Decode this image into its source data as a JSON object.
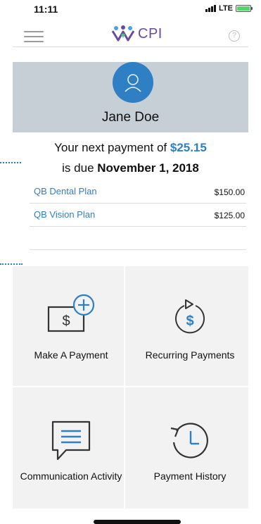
{
  "status": {
    "time": "11:11",
    "network": "LTE"
  },
  "header": {
    "logo_text": "CPI",
    "help_symbol": "?"
  },
  "profile": {
    "name": "Jane Doe"
  },
  "payment": {
    "prefix": "Your next payment of ",
    "amount": "$25.15",
    "due_prefix": "is due ",
    "due_date": "November 1, 2018"
  },
  "plans": [
    {
      "name": "QB Dental Plan",
      "amount": "$150.00"
    },
    {
      "name": "QB Vision Plan",
      "amount": "$125.00"
    }
  ],
  "tiles": [
    {
      "label": "Make A Payment",
      "icon": "make-payment-icon"
    },
    {
      "label": "Recurring Payments",
      "icon": "recurring-payments-icon"
    },
    {
      "label": "Communication Activity",
      "icon": "communication-icon"
    },
    {
      "label": "Payment History",
      "icon": "history-icon"
    }
  ],
  "colors": {
    "accent": "#2f7fc4",
    "profile_bg": "#c7cfd6",
    "logo": "#6a4aa0",
    "tile_bg": "#f2f2f2"
  }
}
